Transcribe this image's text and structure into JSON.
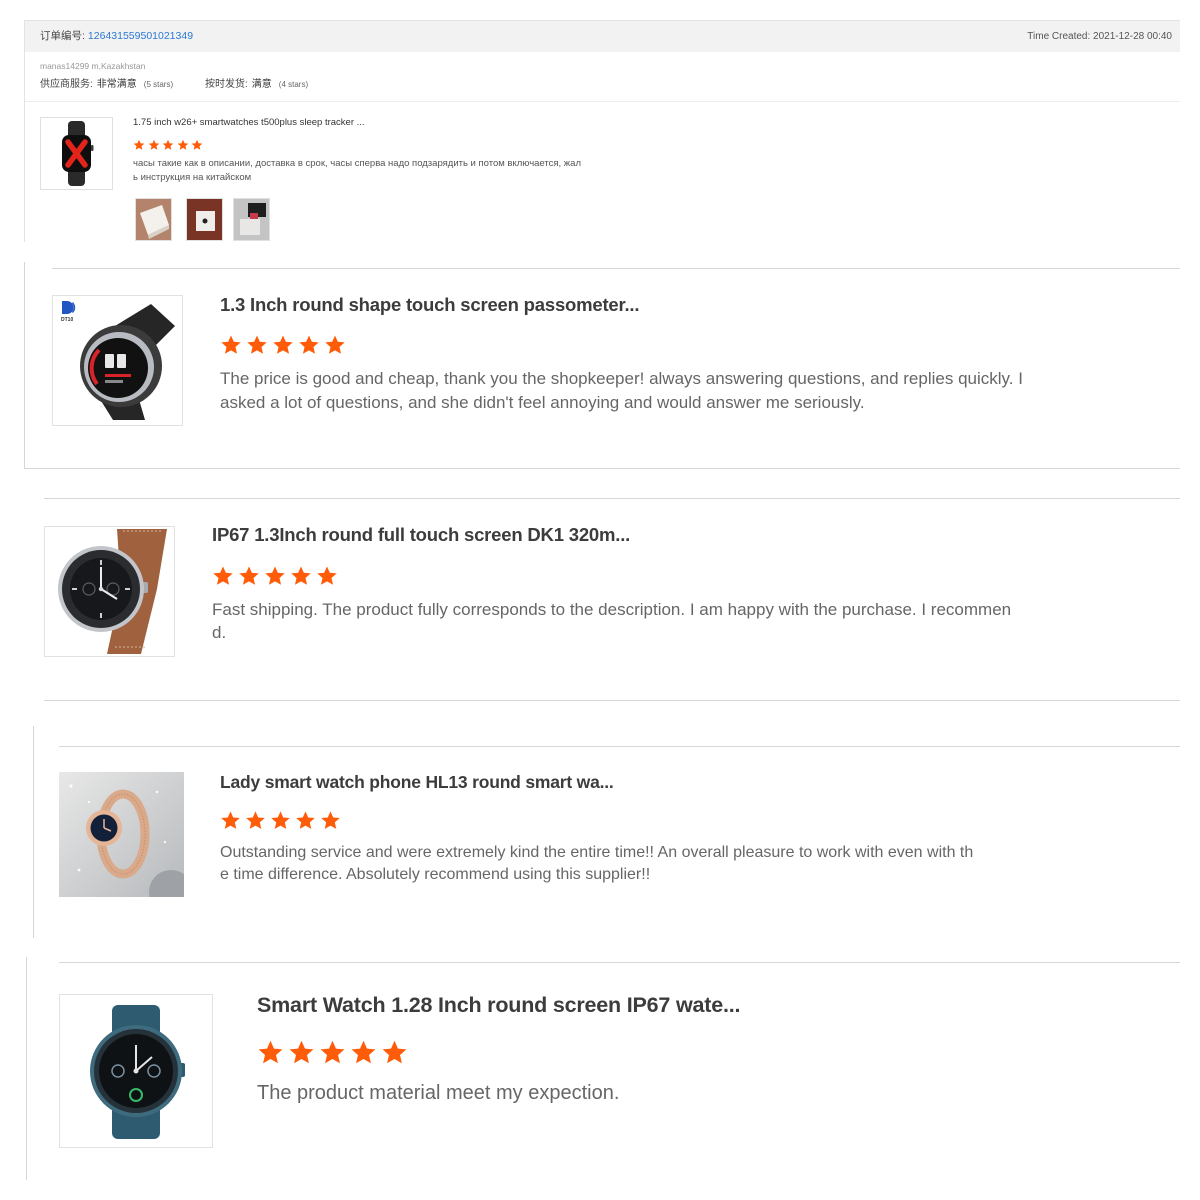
{
  "colors": {
    "star": "#ff5c0a",
    "link": "#2b79d3",
    "header_bg": "#f2f2f2"
  },
  "order": {
    "order_no_label": "订单编号:",
    "order_no": "126431559501021349",
    "time_created": "Time Created: 2021-12-28 00:40",
    "buyer": "manas14299 m,Kazakhstan",
    "seller_ratings": [
      {
        "label": "供应商服务:",
        "value": "非常满意",
        "stars_text": "(5 stars)"
      },
      {
        "label": "按时发货:",
        "value": "满意",
        "stars_text": "(4 stars)"
      }
    ],
    "product": {
      "title": "1.75 inch w26+ smartwatches t500plus sleep tracker ...",
      "rating": 5,
      "review_lines": [
        "часы такие как в описании, доставка в срок, часы сперва надо подзарядить и потом включается, жал",
        "ь инструкция на китайском"
      ]
    }
  },
  "reviews": [
    {
      "image_logo_text": "DT10",
      "title": "1.3 Inch round shape touch screen passometer...",
      "rating": 5,
      "review_lines": [
        "The price is good and cheap, thank you the shopkeeper! always answering questions, and replies quickly. I",
        "asked a lot of questions, and she didn't feel annoying and would answer me seriously."
      ]
    },
    {
      "title": "IP67 1.3Inch round full touch screen DK1 320m...",
      "rating": 5,
      "review_lines": [
        "Fast shipping. The product fully corresponds to the description. I am happy with the purchase. I recommen",
        "d."
      ]
    },
    {
      "title": "Lady smart watch phone HL13 round smart wa...",
      "rating": 5,
      "review_lines": [
        "Outstanding service and were extremely kind the entire time!! An overall pleasure to work with even with th",
        "e time difference. Absolutely recommend using this supplier!!"
      ]
    },
    {
      "title": "Smart Watch 1.28 Inch round screen IP67 wate...",
      "rating": 5,
      "review_lines": [
        "The product material meet my expection."
      ]
    }
  ]
}
